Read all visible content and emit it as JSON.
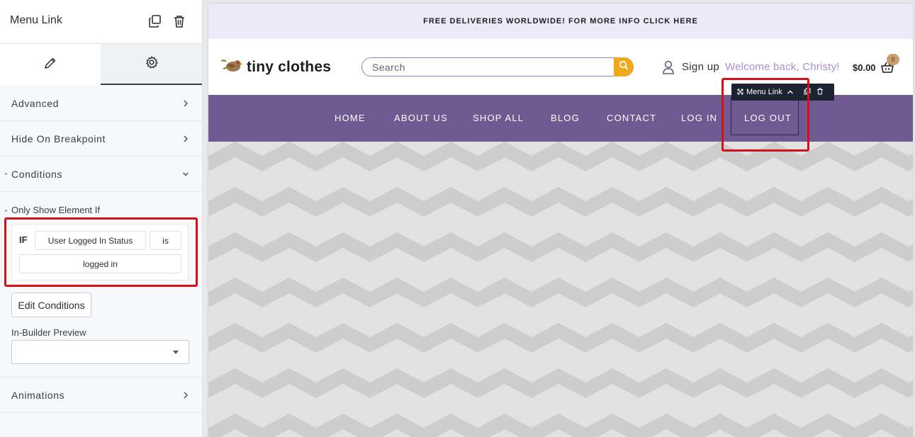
{
  "panel": {
    "title": "Menu Link",
    "sections": {
      "advanced": "Advanced",
      "hide_on_breakpoint": "Hide On Breakpoint",
      "conditions": "Conditions",
      "animations": "Animations"
    },
    "only_show_label": "Only Show Element If",
    "condition": {
      "if_label": "IF",
      "field": "User Logged In Status",
      "operator": "is",
      "value": "logged in"
    },
    "edit_conditions_label": "Edit Conditions",
    "in_builder_preview_label": "In-Builder Preview",
    "in_builder_preview_value": ""
  },
  "site": {
    "topbar_text": "FREE DELIVERIES WORLDWIDE! FOR MORE INFO CLICK HERE",
    "logo_text": "tiny clothes",
    "search_placeholder": "Search",
    "signup": "Sign up",
    "welcome": "Welcome back, Christy!",
    "cart_total": "$0.00",
    "cart_count": "0",
    "nav": [
      "HOME",
      "ABOUT US",
      "SHOP ALL",
      "BLOG",
      "CONTACT",
      "LOG IN",
      "LOG OUT"
    ],
    "editor_toolbar_label": "Menu Link"
  },
  "colors": {
    "nav_bg": "#6f5b92",
    "topbar_bg": "#ece9f8",
    "accent_orange": "#f0a81c",
    "welcome_text": "#a88fd6",
    "highlight_red": "#d4111a",
    "toolbar_bg": "#1d2431"
  },
  "icons": {
    "duplicate": "duplicate-icon",
    "delete": "trash-icon",
    "edit_tab": "pencil-icon",
    "settings_tab": "gear-icon",
    "chevron": "chevron-right-icon",
    "search": "search-icon",
    "user": "user-icon",
    "cart": "basket-icon"
  }
}
